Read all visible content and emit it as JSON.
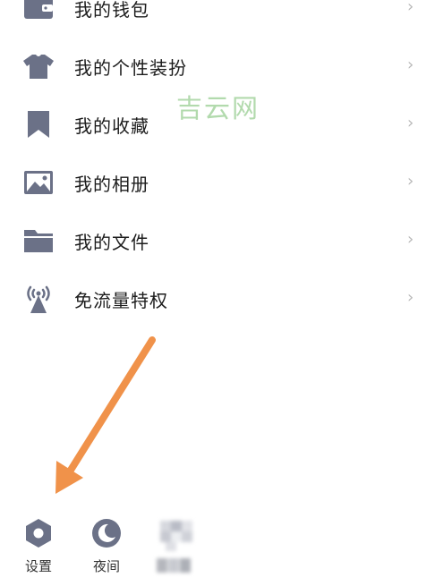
{
  "menu": {
    "items": [
      {
        "label": "我的钱包",
        "icon": "wallet-icon"
      },
      {
        "label": "我的个性装扮",
        "icon": "shirt-icon"
      },
      {
        "label": "我的收藏",
        "icon": "bookmark-icon"
      },
      {
        "label": "我的相册",
        "icon": "photo-icon"
      },
      {
        "label": "我的文件",
        "icon": "folder-icon"
      },
      {
        "label": "免流量特权",
        "icon": "signal-tower-icon"
      }
    ],
    "chevron": "›"
  },
  "watermark": "吉云网",
  "bottom": {
    "settings_label": "设置",
    "night_label": "夜间"
  },
  "colors": {
    "icon": "#6b7187",
    "arrow": "#f0924a",
    "watermark": "#a5d49f",
    "chevron": "#b8b8b8"
  }
}
